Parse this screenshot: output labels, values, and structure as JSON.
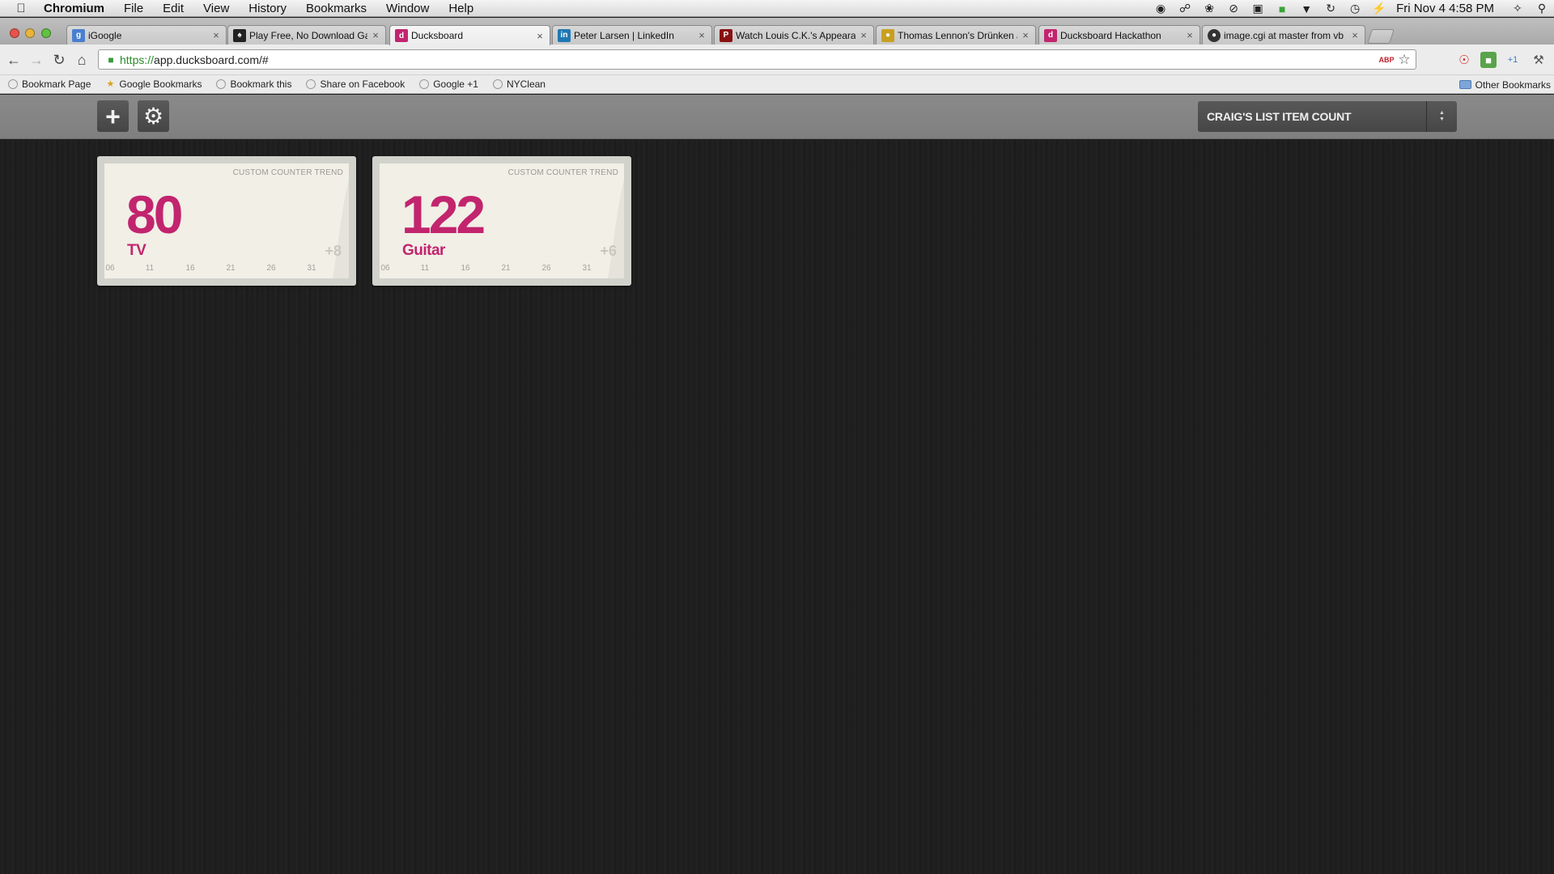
{
  "menubar": {
    "app_name": "Chromium",
    "menus": [
      "File",
      "Edit",
      "View",
      "History",
      "Bookmarks",
      "Window",
      "Help"
    ],
    "clock": "Fri Nov 4  4:58 PM"
  },
  "tabs": [
    {
      "title": "iGoogle",
      "favicon": "google-icon",
      "active": false
    },
    {
      "title": "Play Free, No Download Gam",
      "favicon": "game-icon",
      "active": false
    },
    {
      "title": "Ducksboard",
      "favicon": "ducksboard-icon",
      "active": true
    },
    {
      "title": "Peter Larsen | LinkedIn",
      "favicon": "linkedin-icon",
      "active": false
    },
    {
      "title": "Watch Louis C.K.'s Appearan",
      "favicon": "pcb-icon",
      "active": false
    },
    {
      "title": "Thomas Lennon's Drünken Ju",
      "favicon": "news-icon",
      "active": false
    },
    {
      "title": "Ducksboard Hackathon",
      "favicon": "ducksboard-icon",
      "active": false
    },
    {
      "title": "image.cgi at master from vb",
      "favicon": "github-icon",
      "active": false
    }
  ],
  "toolbar": {
    "url_scheme": "https://",
    "url_rest": "app.ducksboard.com/#"
  },
  "bookmarks": {
    "items": [
      "Bookmark Page",
      "Google Bookmarks",
      "Bookmark this",
      "Share on Facebook",
      "Google +1",
      "NYClean"
    ],
    "other": "Other Bookmarks"
  },
  "app": {
    "dashboard_name": "CRAIG'S LIST ITEM COUNT",
    "accent_color": "#c2246e",
    "widgets": [
      {
        "kind": "CUSTOM COUNTER TREND",
        "value": "80",
        "label": "TV",
        "delta": "+8",
        "ticks": [
          "06",
          "11",
          "16",
          "21",
          "26",
          "31"
        ]
      },
      {
        "kind": "CUSTOM COUNTER TREND",
        "value": "122",
        "label": "Guitar",
        "delta": "+6",
        "ticks": [
          "06",
          "11",
          "16",
          "21",
          "26",
          "31"
        ]
      }
    ]
  }
}
